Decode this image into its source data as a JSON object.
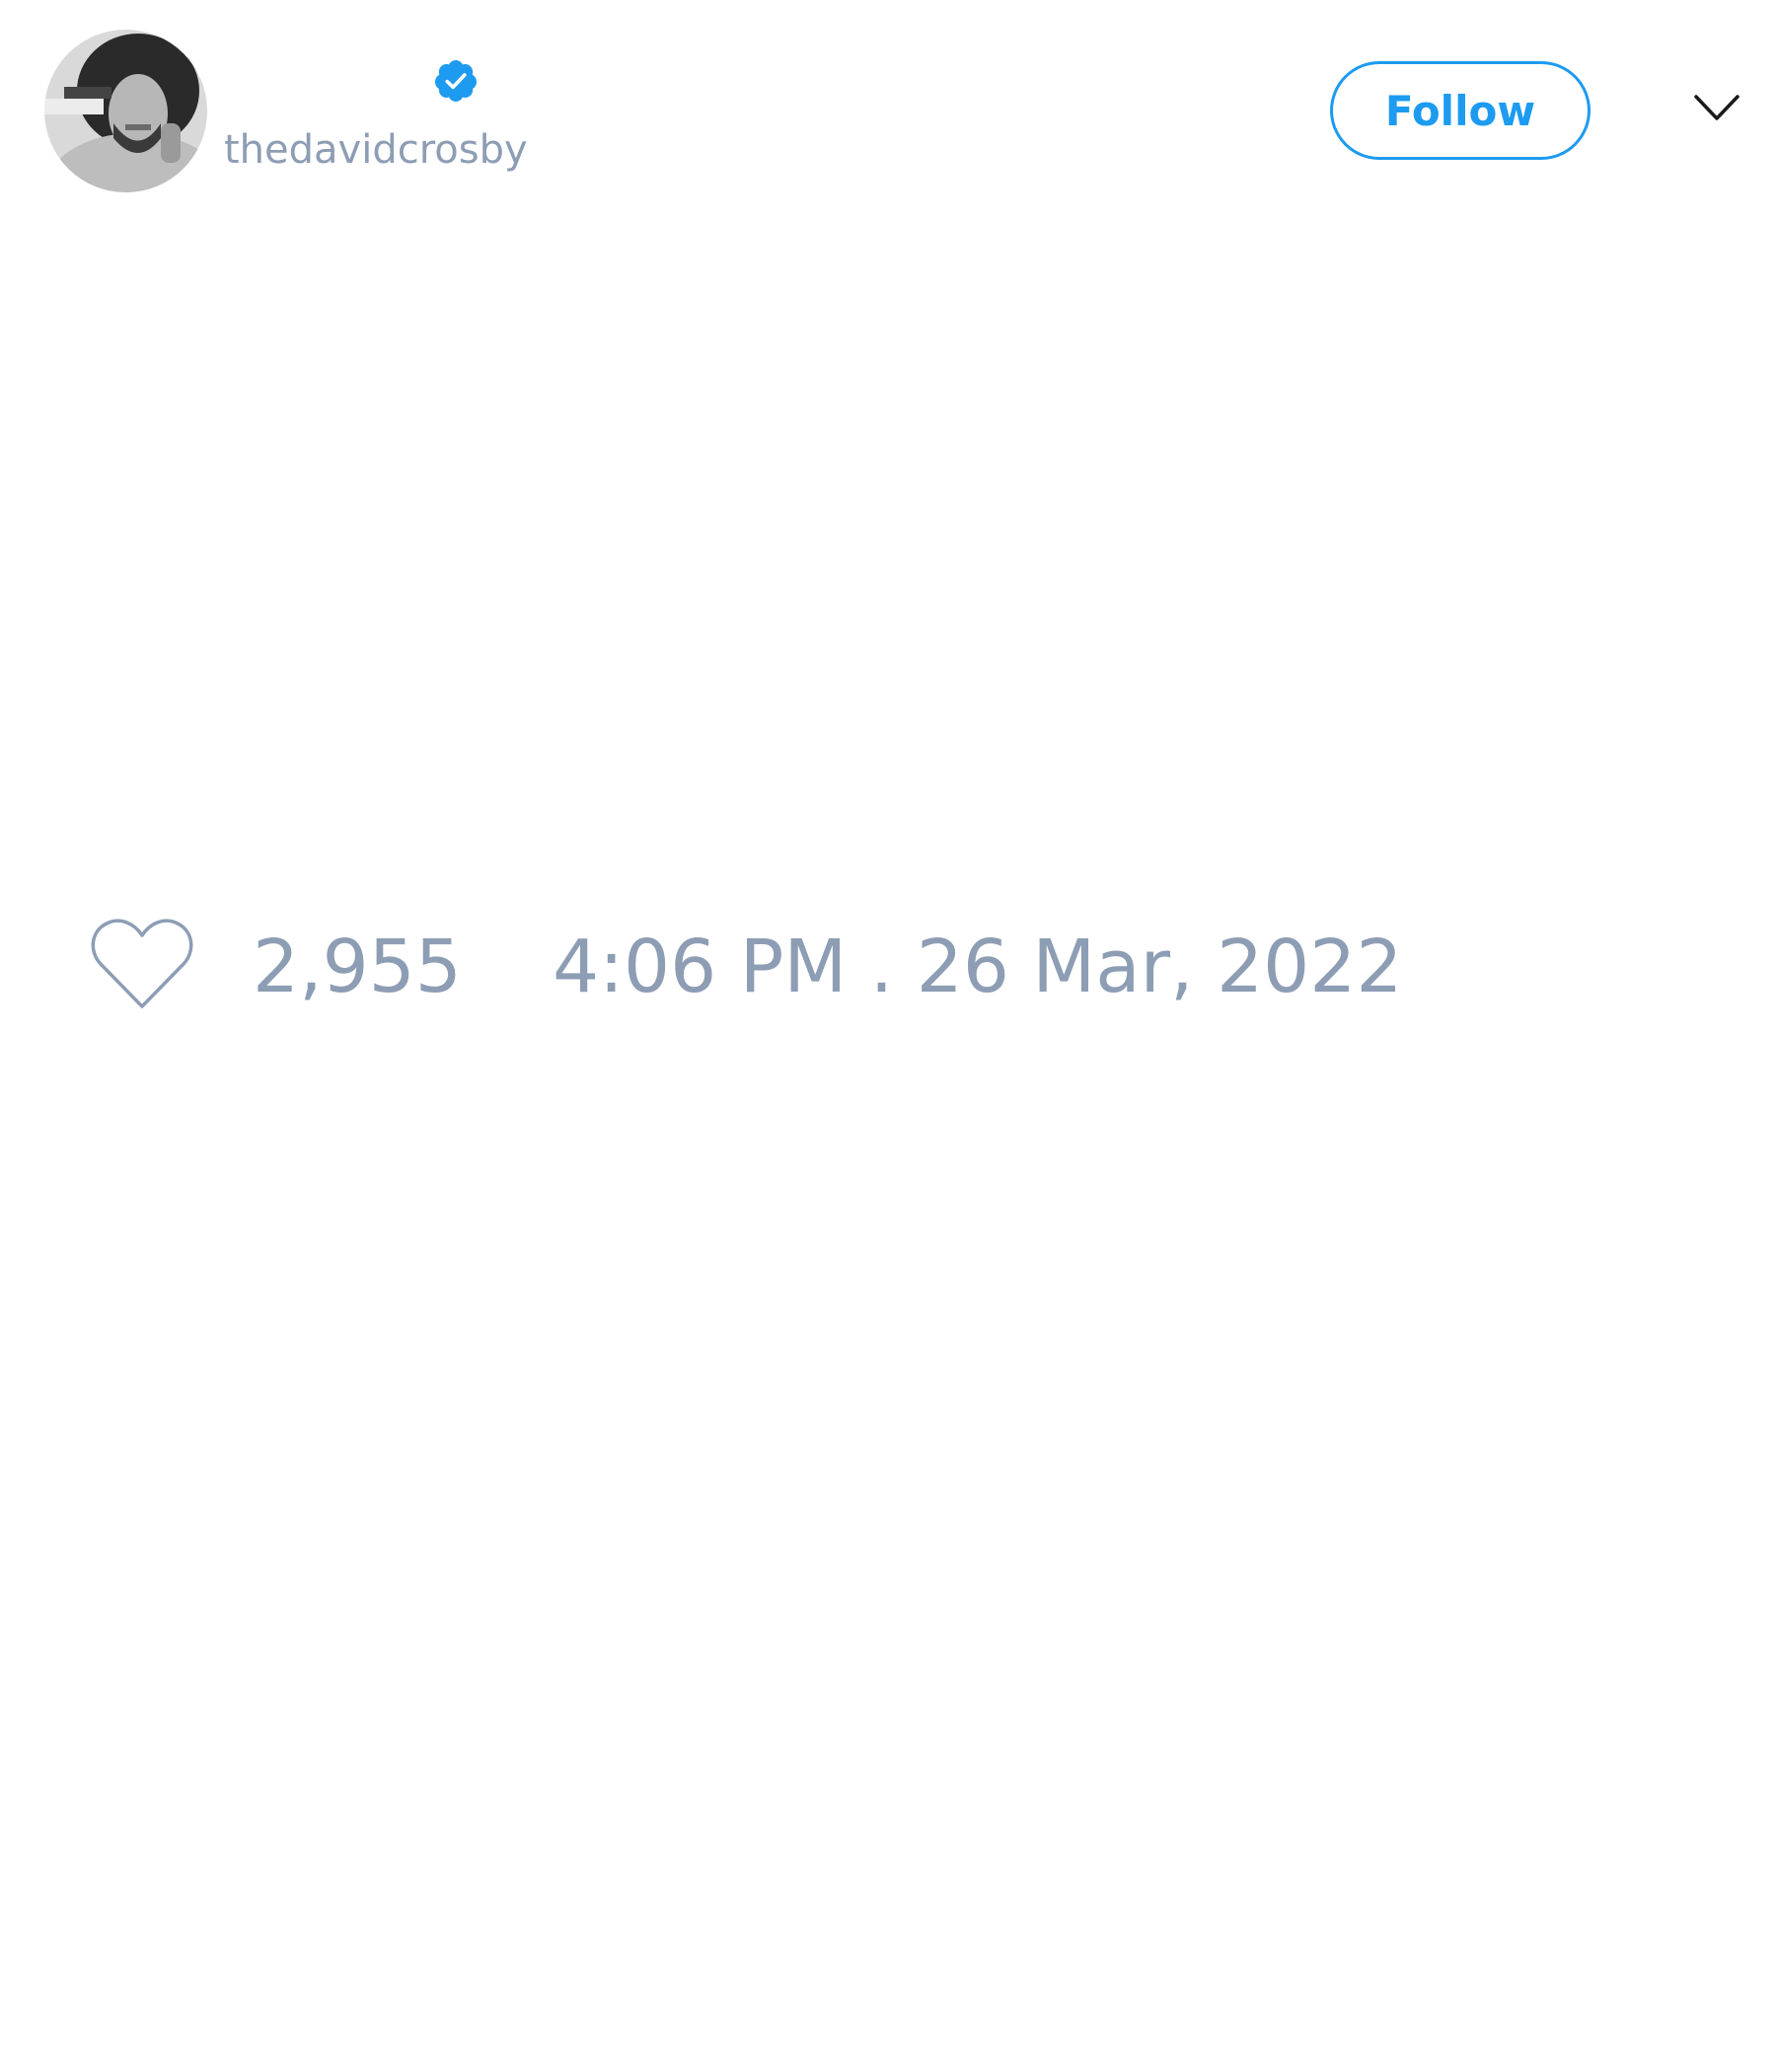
{
  "header": {
    "handle": "thedavidcrosby",
    "verified": true,
    "follow_label": "Follow"
  },
  "footer": {
    "like_count": "2,955",
    "timestamp": "4:06 PM . 26 Mar, 2022"
  },
  "icons": {
    "verified_badge": "verified-badge-icon",
    "menu": "chevron-down-icon",
    "like": "heart-icon"
  },
  "colors": {
    "accent": "#1d9bf0",
    "muted_text": "#8d9db4",
    "heart_stroke": "#8d9db4",
    "chevron": "#1a1a1a"
  }
}
